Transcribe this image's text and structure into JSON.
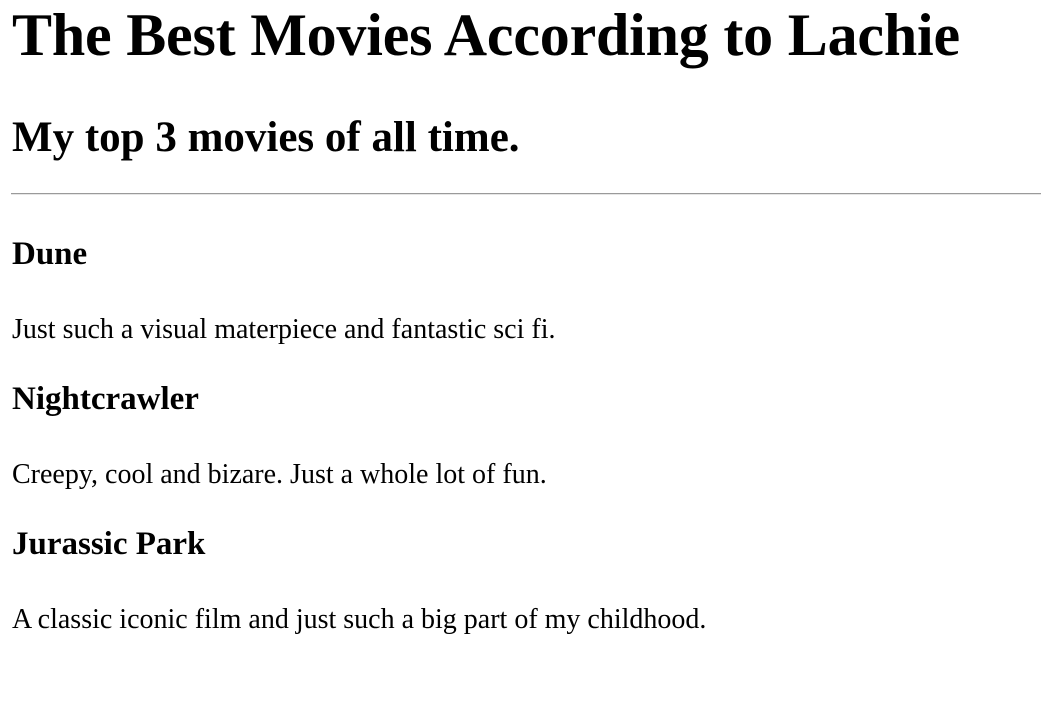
{
  "page": {
    "title": "The Best Movies According to Lachie",
    "subtitle": "My top 3 movies of all time."
  },
  "movies": [
    {
      "title": "Dune",
      "description": "Just such a visual materpiece and fantastic sci fi."
    },
    {
      "title": "Nightcrawler",
      "description": "Creepy, cool and bizare. Just a whole lot of fun."
    },
    {
      "title": "Jurassic Park",
      "description": "A classic iconic film and just such a big part of my childhood."
    }
  ]
}
